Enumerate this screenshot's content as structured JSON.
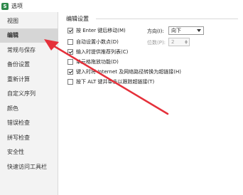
{
  "window": {
    "app_icon_glyph": "S",
    "title": "选项"
  },
  "sidebar": {
    "items": [
      {
        "label": "视图"
      },
      {
        "label": "编辑"
      },
      {
        "label": "常规与保存"
      },
      {
        "label": "备份设置"
      },
      {
        "label": "重新计算"
      },
      {
        "label": "自定义序列"
      },
      {
        "label": "颜色"
      },
      {
        "label": "错误检查"
      },
      {
        "label": "拼写检查"
      },
      {
        "label": "安全性"
      },
      {
        "label": "快速访问工具栏"
      }
    ],
    "active_index": 1
  },
  "edit_settings": {
    "section_title": "编辑设置",
    "options": [
      {
        "label": "按 Enter 键后移动(M)",
        "checked": true,
        "enabled": true
      },
      {
        "label": "自动设置小数点(D)",
        "checked": false,
        "enabled": true
      },
      {
        "label": "输入时提供推荐列表(C)",
        "checked": true,
        "enabled": true
      },
      {
        "label": "单元格拖放功能(D)",
        "checked": false,
        "enabled": true
      },
      {
        "label": "键入时将 Internet 及网络路径转换为超链接(H)",
        "checked": true,
        "enabled": true
      },
      {
        "label": "按下 ALT 键并单击以跟踪超链接(T)",
        "checked": false,
        "enabled": true
      }
    ],
    "direction_label": "方向(I):",
    "direction_value": "向下",
    "places_label": "位数(P):",
    "places_value": "2"
  },
  "annotation": {
    "arrow_color": "#e5303a"
  }
}
